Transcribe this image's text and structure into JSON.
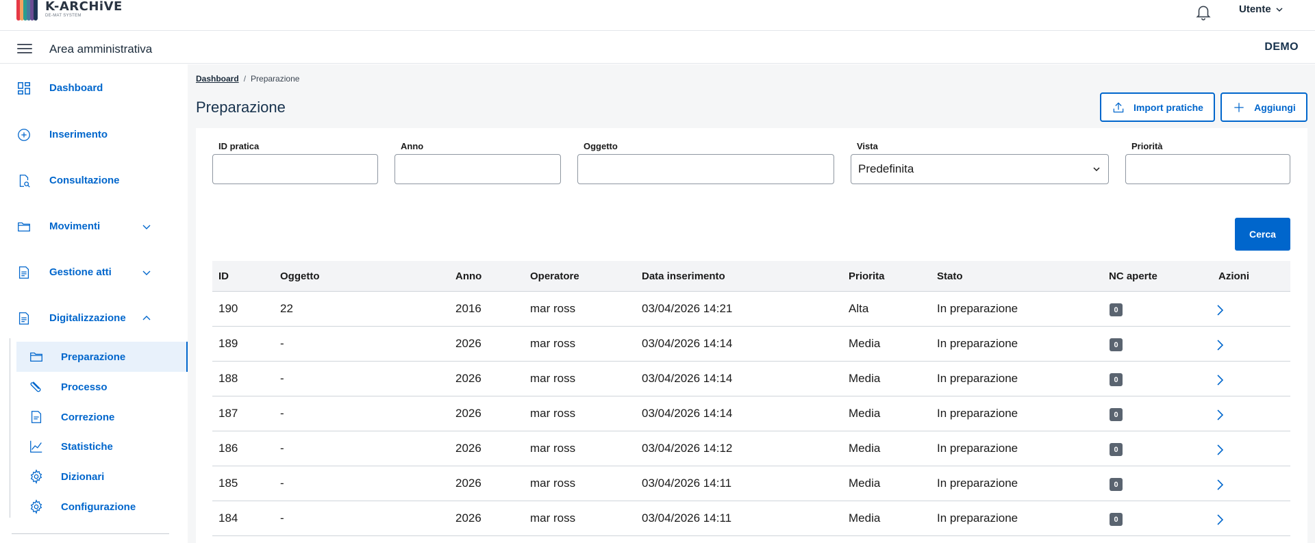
{
  "app": {
    "logo_title": "K-ARCHiVE",
    "logo_subtitle": "DE-MAT SYSTEM",
    "user_label": "Utente",
    "area_title": "Area amministrativa",
    "tenant": "DEMO"
  },
  "colors": {
    "accent": "#0066cc",
    "title": "#17324d",
    "badge": "#5a6470",
    "active_bg": "#e8f1fb"
  },
  "sidebar": {
    "items": [
      {
        "label": "Dashboard",
        "icon": "dashboard-grid-icon"
      },
      {
        "label": "Inserimento",
        "icon": "plus-circle-icon"
      },
      {
        "label": "Consultazione",
        "icon": "document-view-icon"
      },
      {
        "label": "Movimenti",
        "icon": "folder-icon",
        "expandable": true,
        "expanded": false
      },
      {
        "label": "Gestione atti",
        "icon": "document-icon",
        "expandable": true,
        "expanded": false
      },
      {
        "label": "Digitalizzazione",
        "icon": "document-icon",
        "expandable": true,
        "expanded": true
      }
    ],
    "subitems": [
      {
        "label": "Preparazione",
        "icon": "folder-icon",
        "active": true
      },
      {
        "label": "Processo",
        "icon": "clip-icon"
      },
      {
        "label": "Correzione",
        "icon": "document-icon"
      },
      {
        "label": "Statistiche",
        "icon": "chart-line-icon"
      },
      {
        "label": "Dizionari",
        "icon": "gear-icon"
      },
      {
        "label": "Configurazione",
        "icon": "gear-icon"
      }
    ]
  },
  "breadcrumb": {
    "home": "Dashboard",
    "separator": "/",
    "current": "Preparazione"
  },
  "page": {
    "title": "Preparazione",
    "import_button": "Import pratiche",
    "add_button": "Aggiungi"
  },
  "filters": {
    "id_label": "ID pratica",
    "id_value": "",
    "anno_label": "Anno",
    "anno_value": "",
    "oggetto_label": "Oggetto",
    "oggetto_value": "",
    "vista_label": "Vista",
    "vista_value": "Predefinita",
    "priorita_label": "Priorità",
    "priorita_value": "",
    "search_button": "Cerca"
  },
  "table": {
    "columns": [
      "ID",
      "Oggetto",
      "Anno",
      "Operatore",
      "Data inserimento",
      "Priorita",
      "Stato",
      "NC aperte",
      "Azioni"
    ],
    "rows": [
      {
        "id": "190",
        "oggetto": "22",
        "anno": "2016",
        "operatore": "mar ross",
        "data": "03/04/2026 14:21",
        "priorita": "Alta",
        "stato": "In preparazione",
        "nc": "0"
      },
      {
        "id": "189",
        "oggetto": "-",
        "anno": "2026",
        "operatore": "mar ross",
        "data": "03/04/2026 14:14",
        "priorita": "Media",
        "stato": "In preparazione",
        "nc": "0"
      },
      {
        "id": "188",
        "oggetto": "-",
        "anno": "2026",
        "operatore": "mar ross",
        "data": "03/04/2026 14:14",
        "priorita": "Media",
        "stato": "In preparazione",
        "nc": "0"
      },
      {
        "id": "187",
        "oggetto": "-",
        "anno": "2026",
        "operatore": "mar ross",
        "data": "03/04/2026 14:14",
        "priorita": "Media",
        "stato": "In preparazione",
        "nc": "0"
      },
      {
        "id": "186",
        "oggetto": "-",
        "anno": "2026",
        "operatore": "mar ross",
        "data": "03/04/2026 14:12",
        "priorita": "Media",
        "stato": "In preparazione",
        "nc": "0"
      },
      {
        "id": "185",
        "oggetto": "-",
        "anno": "2026",
        "operatore": "mar ross",
        "data": "03/04/2026 14:11",
        "priorita": "Media",
        "stato": "In preparazione",
        "nc": "0"
      },
      {
        "id": "184",
        "oggetto": "-",
        "anno": "2026",
        "operatore": "mar ross",
        "data": "03/04/2026 14:11",
        "priorita": "Media",
        "stato": "In preparazione",
        "nc": "0"
      }
    ]
  }
}
